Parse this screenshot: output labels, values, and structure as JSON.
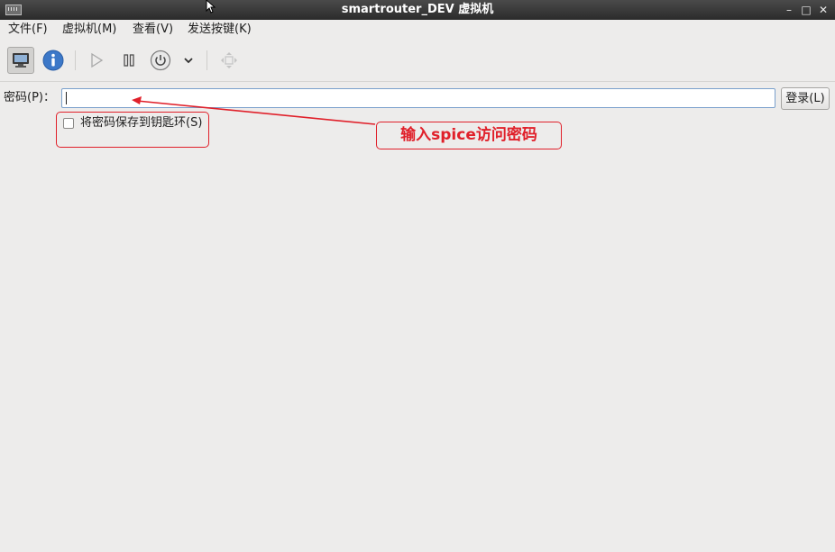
{
  "window": {
    "title": "smartrouter_DEV 虚拟机",
    "minimize": "–",
    "maximize": "□",
    "close": "✕"
  },
  "menu": {
    "items": [
      "文件(F)",
      "虚拟机(M)",
      "查看(V)",
      "发送按键(K)"
    ]
  },
  "toolbar": {
    "buttons": [
      {
        "icon": "monitor-icon",
        "active": true
      },
      {
        "icon": "info-icon",
        "active": false
      },
      {
        "icon": "play-icon",
        "active": false
      },
      {
        "icon": "pause-icon",
        "active": false
      },
      {
        "icon": "power-icon",
        "active": false
      },
      {
        "icon": "chevron-down-icon",
        "active": false
      },
      {
        "icon": "fullscreen-move-icon",
        "active": false
      }
    ]
  },
  "auth": {
    "password_label": "密码(P)：",
    "password_value": "",
    "login_button": "登录(L)",
    "save_checkbox_label": "将密码保存到钥匙环(S)",
    "save_checked": false
  },
  "annotation": {
    "text": "输入spice访问密码",
    "color": "#e0202a"
  }
}
